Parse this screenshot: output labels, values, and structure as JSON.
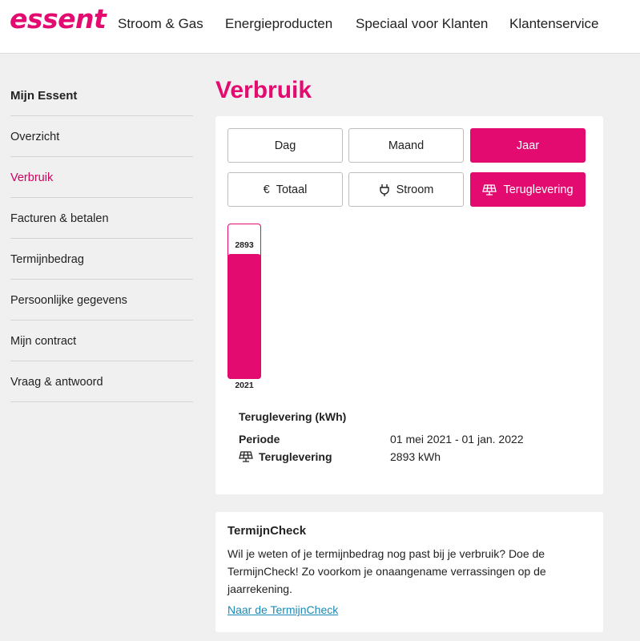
{
  "brand": {
    "logo_text": "essent",
    "accent": "#e30b6f"
  },
  "nav": {
    "items": [
      "Stroom & Gas",
      "Energieproducten",
      "Speciaal voor Klanten",
      "Klantenservice"
    ]
  },
  "sidebar": {
    "title": "Mijn Essent",
    "items": [
      {
        "label": "Overzicht",
        "active": false
      },
      {
        "label": "Verbruik",
        "active": true
      },
      {
        "label": "Facturen & betalen",
        "active": false
      },
      {
        "label": "Termijnbedrag",
        "active": false
      },
      {
        "label": "Persoonlijke gegevens",
        "active": false
      },
      {
        "label": "Mijn contract",
        "active": false
      },
      {
        "label": "Vraag & antwoord",
        "active": false
      }
    ]
  },
  "page": {
    "title": "Verbruik"
  },
  "period_tabs": [
    {
      "label": "Dag",
      "active": false
    },
    {
      "label": "Maand",
      "active": false
    },
    {
      "label": "Jaar",
      "active": true
    }
  ],
  "type_tabs": [
    {
      "label": "Totaal",
      "icon": "euro-icon",
      "active": false
    },
    {
      "label": "Stroom",
      "icon": "plug-icon",
      "active": false
    },
    {
      "label": "Teruglevering",
      "icon": "solar-panel-icon",
      "active": true
    }
  ],
  "chart_data": {
    "type": "bar",
    "categories": [
      "2021"
    ],
    "values": [
      2893
    ],
    "data_labels": [
      "2893"
    ],
    "unit": "kWh"
  },
  "info": {
    "title": "Teruglevering (kWh)",
    "period_label": "Periode",
    "period_value": "01 mei 2021 - 01 jan. 2022",
    "delivery_label": "Teruglevering",
    "delivery_icon": "solar-panel-icon",
    "delivery_value": "2893 kWh"
  },
  "termijncheck": {
    "title": "TermijnCheck",
    "text": "Wil je weten of je termijnbedrag nog past bij je verbruik? Doe de TermijnCheck! Zo voorkom je onaangename verrassingen op de jaarrekening.",
    "link": "Naar de TermijnCheck"
  }
}
